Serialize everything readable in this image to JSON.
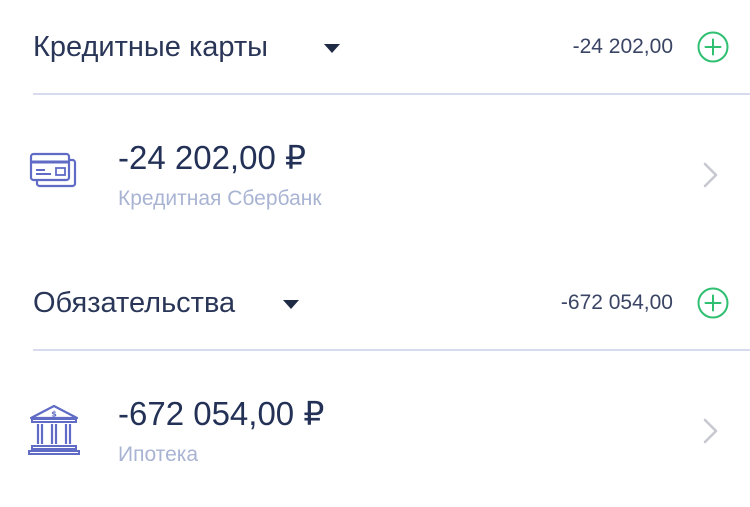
{
  "sections": [
    {
      "title": "Кредитные карты",
      "total": "-24 202,00",
      "accounts": [
        {
          "amount": "-24 202,00 ₽",
          "name": "Кредитная Сбербанк",
          "icon": "credit-card-icon"
        }
      ]
    },
    {
      "title": "Обязательства",
      "total": "-672 054,00",
      "accounts": [
        {
          "amount": "-672 054,00 ₽",
          "name": "Ипотека",
          "icon": "bank-icon"
        }
      ]
    }
  ],
  "colors": {
    "text_primary": "#233157",
    "text_secondary": "#a9b4d3",
    "accent_add": "#2fbf71",
    "icon": "#5f6bc4",
    "divider": "#d6dcee",
    "chevron": "#c7c9d1"
  }
}
